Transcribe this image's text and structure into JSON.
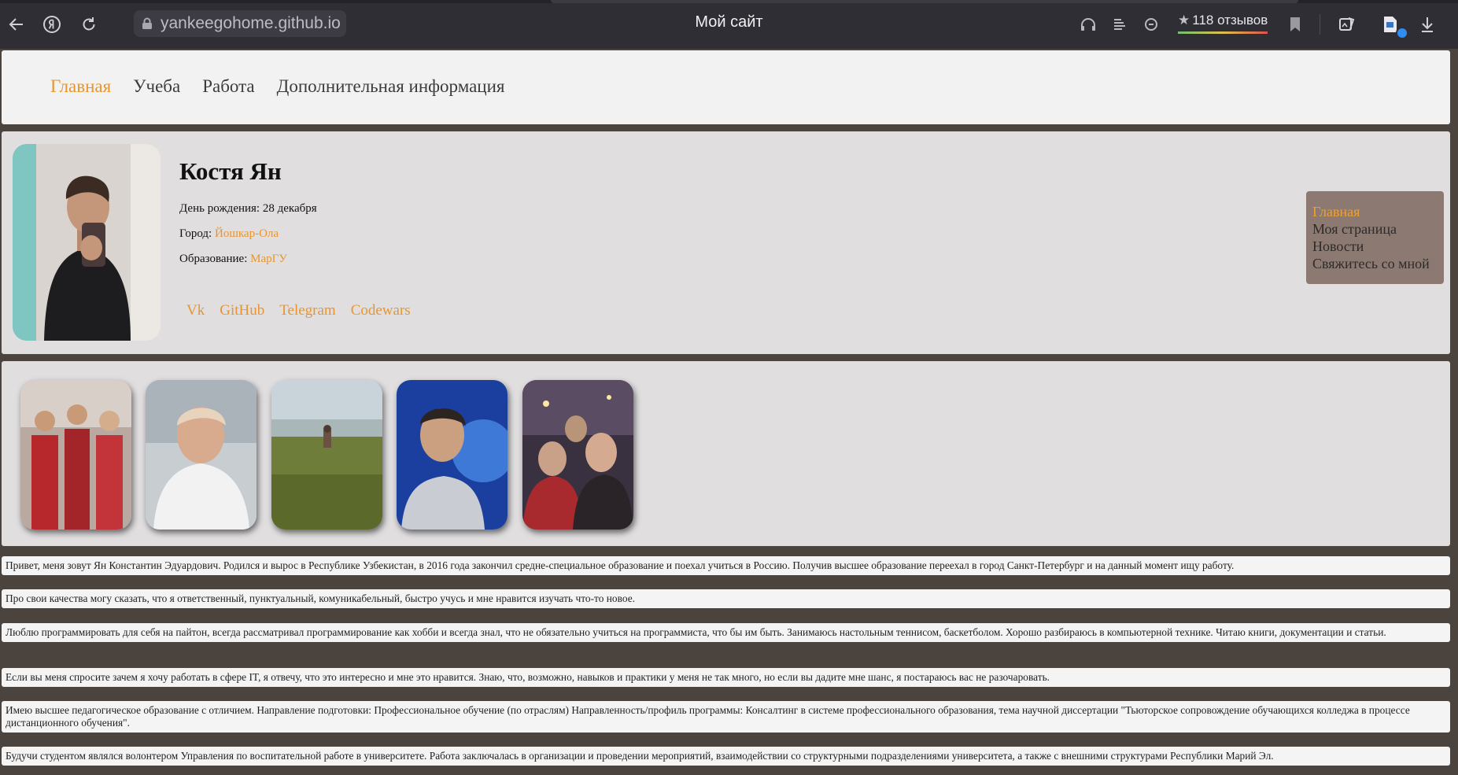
{
  "browser": {
    "url": "yankeegohome.github.io",
    "page_title": "Мой сайт",
    "reviews_text": "118 отзывов",
    "icons": [
      "back-icon",
      "yandex-icon",
      "reload-icon",
      "lock-icon",
      "headphones-icon",
      "reader-icon",
      "chat-icon",
      "star-icon",
      "bookmark-icon",
      "collections-icon",
      "extension-icon",
      "download-icon"
    ]
  },
  "nav": {
    "items": [
      {
        "label": "Главная",
        "active": true
      },
      {
        "label": "Учеба",
        "active": false
      },
      {
        "label": "Работа",
        "active": false
      },
      {
        "label": "Дополнительная информация",
        "active": false
      }
    ]
  },
  "profile": {
    "name": "Костя Ян",
    "birthday_label": "День рождения:",
    "birthday_value": "28 декабря",
    "city_label": "Город:",
    "city_value": "Йошкар-Ола",
    "education_label": "Образование:",
    "education_value": "МарГУ",
    "socials": [
      "Vk",
      "GitHub",
      "Telegram",
      "Codewars"
    ]
  },
  "side_menu": {
    "items": [
      {
        "label": "Главная",
        "active": true
      },
      {
        "label": "Моя страница",
        "active": false
      },
      {
        "label": "Новости",
        "active": false
      },
      {
        "label": "Свяжитесь со мной",
        "active": false
      }
    ]
  },
  "gallery": {
    "photos": [
      "group-photo",
      "selfie-photo",
      "field-photo",
      "aquarium-photo",
      "night-photo"
    ]
  },
  "paragraphs": [
    "Привет, меня зовут Ян Константин Эдуардович. Родился и вырос в Республике Узбекистан, в 2016 года закончил средне-специальное образование и поехал учиться в Россию. Получив высшее образование переехал в город Санкт-Петербург и на данный момент ищу работу.",
    "Про свои качества могу сказать, что я ответственный, пунктуальный, комуникабельный, быстро учусь и мне нравится изучать что-то новое.",
    "Люблю программировать для себя на пайтон, всегда рассматривал программирование как хобби и всегда знал, что не обязательно учиться на программиста, что бы им быть. Занимаюсь настольным теннисом, баскетболом. Хорошо разбираюсь в компьютерной технике. Читаю книги, документации и статьи.",
    "Если вы меня спросите зачем я хочу работать в сфере IT, я отвечу, что это интересно и мне это нравится. Знаю, что, возможно, навыков и практики у меня не так много, но если вы дадите мне шанс, я постараюсь вас не разочаровать.",
    "Имею высшее педагогическое образование с отличием. Направление подготовки: Профессиональное обучение (по отраслям) Направленность/профиль программы: Консалтинг в системе профессионального образования, тема научной диссертации \"Тьюторское сопровождение обучающихся колледжа в процессе дистанционного обучения\".",
    "Будучи студентом являлся волонтером Управления по воспитательной работе в университете. Работа заключалась в организации и проведении мероприятий, взаимодействии со структурными подразделениями университета, а также с внешними структурами Республики Марий Эл."
  ]
}
